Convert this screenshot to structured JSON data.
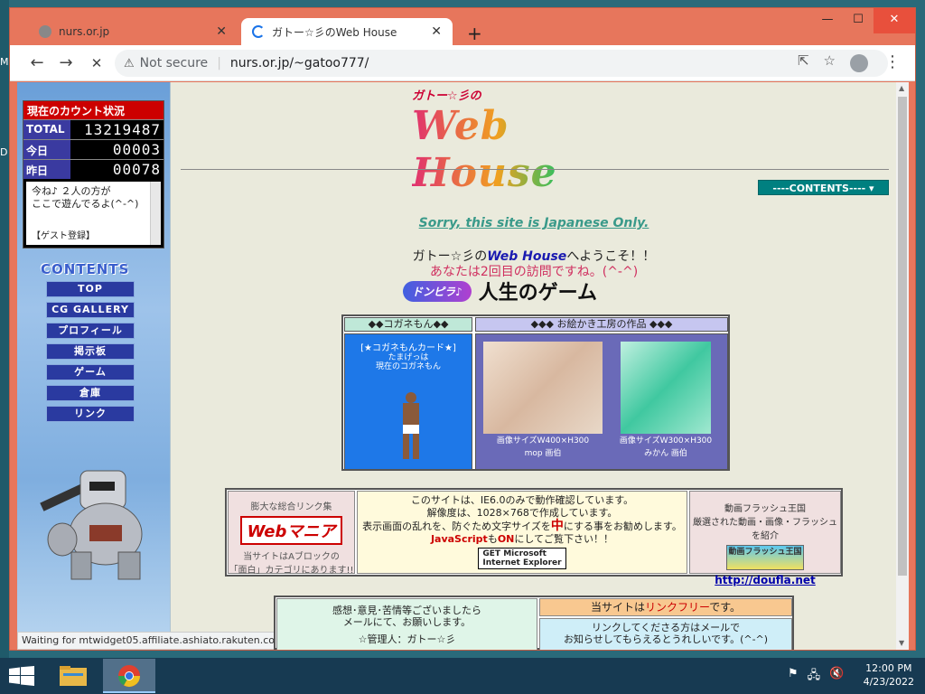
{
  "desktop": {
    "left_letters": [
      "M",
      "D"
    ]
  },
  "window": {
    "controls": {
      "minimize": "—",
      "maximize": "☐",
      "close": "✕"
    },
    "tabs": [
      {
        "title": "nurs.or.jp",
        "active": false
      },
      {
        "title": "ガトー☆彡のWeb House",
        "active": true
      }
    ],
    "new_tab": "+"
  },
  "toolbar": {
    "back": "←",
    "forward": "→",
    "stop": "✕",
    "security_icon": "⚠",
    "security_text": "Not secure",
    "url": "nurs.or.jp/~gatoo777/",
    "share": "⇱",
    "star": "☆",
    "menu": "⋮"
  },
  "counter": {
    "header": "現在のカウント状況",
    "rows": [
      {
        "label": "TOTAL",
        "value": "13219487"
      },
      {
        "label": "今日",
        "value": "00003"
      },
      {
        "label": "昨日",
        "value": "00078"
      }
    ],
    "message_line1": "今ね♪ ２人の方が",
    "message_line2": "ここで遊んでるよ(^-^)",
    "guest": "【ゲスト登録】"
  },
  "sidebar": {
    "title": "CONTENTS",
    "items": [
      "TOP",
      "CG GALLERY",
      "プロフィール",
      "掲示板",
      "ゲーム",
      "倉庫",
      "リンク"
    ]
  },
  "status_bar": "Waiting for mtwidget05.affiliate.ashiato.rakuten.co.jp...",
  "main": {
    "logo_small": "ガトー☆彡の",
    "logo_big": "Web House",
    "contents_select": "----CONTENTS---- ▾",
    "sorry": "Sorry, this site is Japanese Only.",
    "welcome_pre": "ガトー☆彡の",
    "welcome_site": "Web House",
    "welcome_post": "へようこそ！！",
    "visit": "あなたは2回目の訪問ですね。(^-^)",
    "game_banner_left": "ドンピラ♪",
    "game_banner_right": "人生のゲーム"
  },
  "gallery": {
    "header_left": "◆◆コガネもん◆◆",
    "header_right": "◆◆◆ お絵かき工房の作品 ◆◆◆",
    "card_title": "[★コガネもんカード★]",
    "card_sub1": "たまげっは",
    "card_sub2": "現在のコガネもん",
    "pic1_size": "画像サイズW400×H300",
    "pic1_author": "mop 画伯",
    "pic2_size": "画像サイズW300×H300",
    "pic2_author": "みかん 画伯"
  },
  "info": {
    "left_title": "膨大な総合リンク集",
    "webmania": "Webマニア",
    "left_note1": "当サイトはAブロックの",
    "left_note2": "「面白」カテゴリにあります!!",
    "mid_line1": "このサイトは、IE6.0のみで動作確認しています。",
    "mid_line2": "解像度は、1028×768で作成しています。",
    "mid_line3_pre": "表示画面の乱れを、防ぐため文字サイズを",
    "mid_line3_red": "中",
    "mid_line3_post": "にする事をお勧めします。",
    "mid_line4_red1": "JavaScript",
    "mid_line4_mid": "も",
    "mid_line4_red2": "ON",
    "mid_line4_post": "にしてご覧下さい！！",
    "ie_badge_line1": "GET Microsoft",
    "ie_badge_line2": "Internet Explorer",
    "right_title": "動画フラッシュ王国",
    "right_note": "厳選された動画・画像・フラッシュを紹介",
    "right_banner": "動画フラッシュ王国",
    "right_link": "http://doufla.net"
  },
  "bottom": {
    "left_line1": "感想･意見･苦情等ございましたら",
    "left_line2": "メールにて、お願いします。",
    "left_line3": "☆管理人：ガトー☆彡",
    "right_title_pre": "当サイトは",
    "right_title_red": "リンクフリー",
    "right_title_post": "です。",
    "right_line1": "リンクしてくださる方はメールで",
    "right_line2": "お知らせしてもらえるとうれしいです。(^-^)"
  },
  "taskbar": {
    "time": "12:00 PM",
    "date": "4/23/2022",
    "apps": [
      "file-explorer",
      "chrome"
    ]
  }
}
